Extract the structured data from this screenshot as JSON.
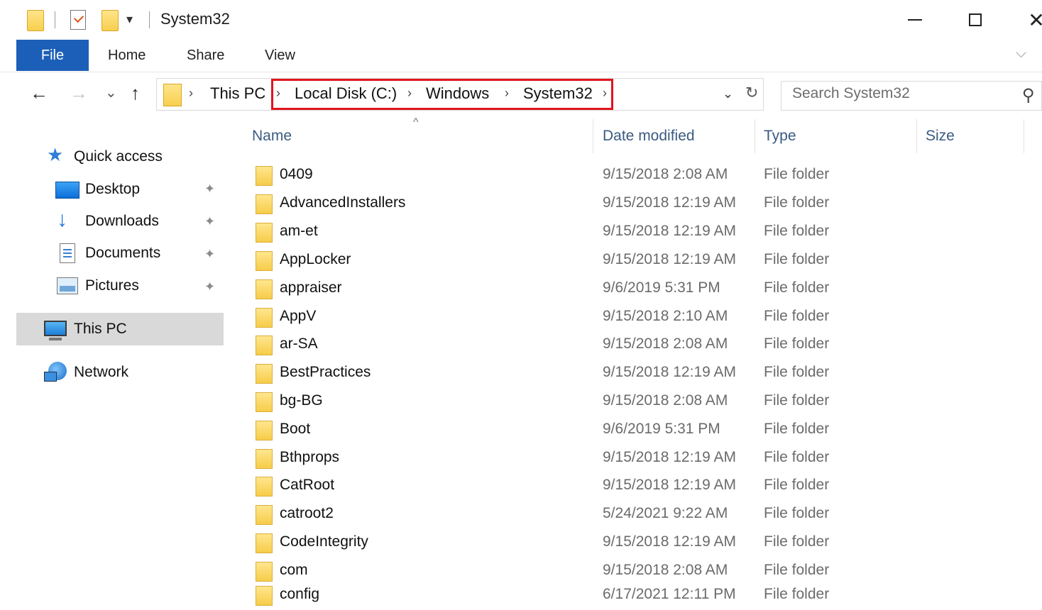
{
  "window": {
    "title": "System32",
    "minimize_glyph": "—",
    "close_glyph": "✕",
    "dropdown_glyph": "▾"
  },
  "ribbon": {
    "tabs": [
      "File",
      "Home",
      "Share",
      "View"
    ],
    "active_tab": "File",
    "accent": "#1c5fb8",
    "chevron": "⌵"
  },
  "nav": {
    "back_glyph": "←",
    "forward_glyph": "→",
    "recent_glyph": "⌄",
    "up_glyph": "↑"
  },
  "address": {
    "crumbs": [
      "This PC",
      "Local Disk (C:)",
      "Windows",
      "System32"
    ],
    "separator": "›",
    "highlight_color": "#e0141e",
    "dropdown_glyph": "⌄",
    "refresh_glyph": "↻"
  },
  "search": {
    "placeholder": "Search System32",
    "icon": "search-icon"
  },
  "navpane": {
    "quick_access": "Quick access",
    "items": [
      {
        "label": "Desktop",
        "icon": "desktop-icon",
        "pinned": true
      },
      {
        "label": "Downloads",
        "icon": "download-icon",
        "pinned": true
      },
      {
        "label": "Documents",
        "icon": "documents-icon",
        "pinned": true
      },
      {
        "label": "Pictures",
        "icon": "pictures-icon",
        "pinned": true
      }
    ],
    "this_pc": "This PC",
    "network": "Network",
    "pin_glyph": "📌"
  },
  "columns": {
    "name": "Name",
    "date": "Date modified",
    "type": "Type",
    "size": "Size",
    "sort_glyph": "^"
  },
  "files": [
    {
      "name": "0409",
      "date": "9/15/2018 2:08 AM",
      "type": "File folder"
    },
    {
      "name": "AdvancedInstallers",
      "date": "9/15/2018 12:19 AM",
      "type": "File folder"
    },
    {
      "name": "am-et",
      "date": "9/15/2018 12:19 AM",
      "type": "File folder"
    },
    {
      "name": "AppLocker",
      "date": "9/15/2018 12:19 AM",
      "type": "File folder"
    },
    {
      "name": "appraiser",
      "date": "9/6/2019 5:31 PM",
      "type": "File folder"
    },
    {
      "name": "AppV",
      "date": "9/15/2018 2:10 AM",
      "type": "File folder"
    },
    {
      "name": "ar-SA",
      "date": "9/15/2018 2:08 AM",
      "type": "File folder"
    },
    {
      "name": "BestPractices",
      "date": "9/15/2018 12:19 AM",
      "type": "File folder"
    },
    {
      "name": "bg-BG",
      "date": "9/15/2018 2:08 AM",
      "type": "File folder"
    },
    {
      "name": "Boot",
      "date": "9/6/2019 5:31 PM",
      "type": "File folder"
    },
    {
      "name": "Bthprops",
      "date": "9/15/2018 12:19 AM",
      "type": "File folder"
    },
    {
      "name": "CatRoot",
      "date": "9/15/2018 12:19 AM",
      "type": "File folder"
    },
    {
      "name": "catroot2",
      "date": "5/24/2021 9:22 AM",
      "type": "File folder"
    },
    {
      "name": "CodeIntegrity",
      "date": "9/15/2018 12:19 AM",
      "type": "File folder"
    },
    {
      "name": "com",
      "date": "9/15/2018 2:08 AM",
      "type": "File folder"
    },
    {
      "name": "config",
      "date": "6/17/2021 12:11 PM",
      "type": "File folder"
    }
  ]
}
